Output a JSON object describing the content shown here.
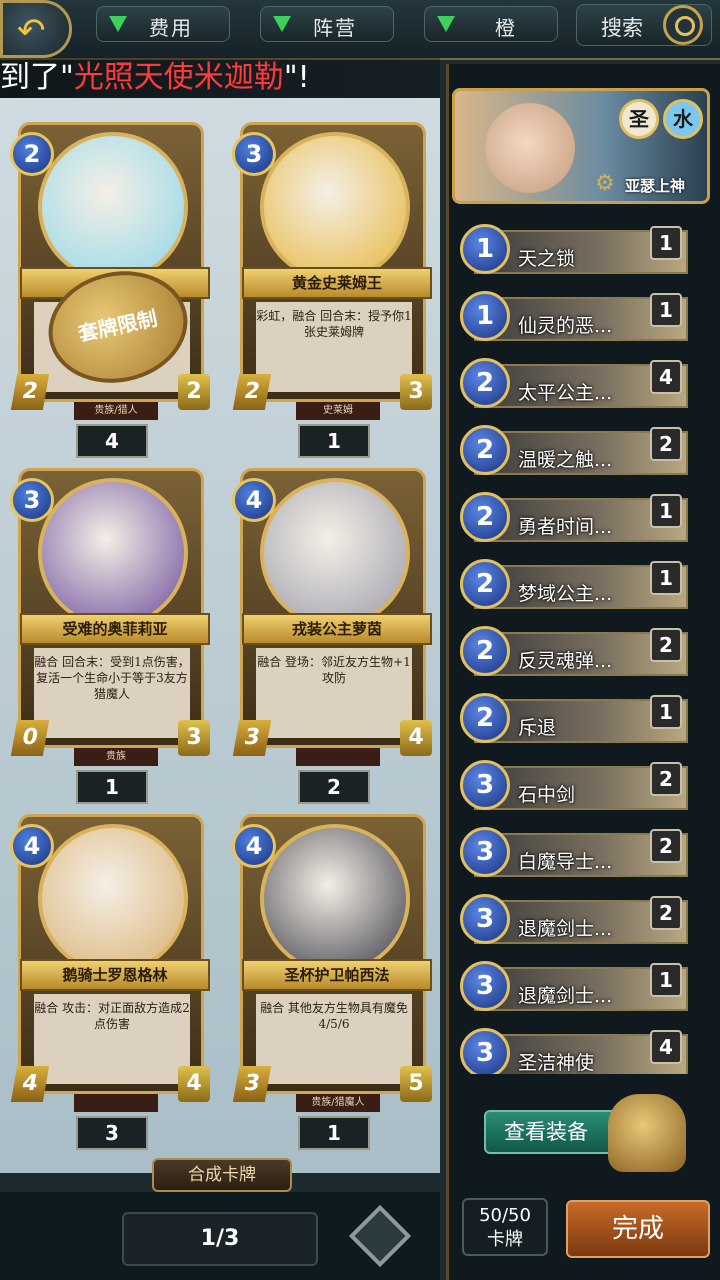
{
  "topbar": {
    "filters": [
      {
        "label": "费用"
      },
      {
        "label": "阵营"
      },
      {
        "label": "橙"
      }
    ],
    "search_label": "搜索"
  },
  "banner": {
    "prefix": "到了\"",
    "highlight": "光照天使米迦勒",
    "suffix": "\"!"
  },
  "cards": [
    {
      "name": "",
      "desc": "",
      "cost": "2",
      "atk": "2",
      "hp": "2",
      "tribe": "贵族/猎人",
      "count": "4",
      "seal": "套牌限制",
      "art_color": "#8fd6e8"
    },
    {
      "name": "黄金史莱姆王",
      "desc": "彩虹，融合\n回合末：授予你1张史莱姆牌",
      "cost": "3",
      "atk": "2",
      "hp": "3",
      "tribe": "史莱姆",
      "count": "1",
      "art_color": "#e6b53a"
    },
    {
      "name": "受难的奥菲莉亚",
      "desc": "融合\n回合末：受到1点伤害，复活一个生命小于等于3友方猎魔人",
      "cost": "3",
      "atk": "0",
      "hp": "3",
      "tribe": "贵族",
      "count": "1",
      "art_color": "#6a4a9a"
    },
    {
      "name": "戎装公主萝茵",
      "desc": "融合\n登场：邻近友方生物+1攻防",
      "cost": "4",
      "atk": "3",
      "hp": "4",
      "tribe": "",
      "count": "2",
      "art_color": "#9a9aa8"
    },
    {
      "name": "鹅骑士罗恩格林",
      "desc": "融合\n攻击：对正面敌方造成2点伤害",
      "cost": "4",
      "atk": "4",
      "hp": "4",
      "tribe": "",
      "count": "3",
      "art_color": "#d8b070"
    },
    {
      "name": "圣杯护卫帕西法",
      "desc": "融合\n其他友方生物具有魔免4/5/6",
      "cost": "4",
      "atk": "3",
      "hp": "5",
      "tribe": "贵族/猎魔人",
      "count": "1",
      "art_color": "#3a3a44"
    }
  ],
  "synth_label": "合成卡牌",
  "pager": "1/3",
  "hero": {
    "elements": [
      "圣",
      "水"
    ],
    "name": "亚瑟上神"
  },
  "deck": [
    {
      "cost": "1",
      "name": "天之锁",
      "qty": "1"
    },
    {
      "cost": "1",
      "name": "仙灵的恶...",
      "qty": "1"
    },
    {
      "cost": "2",
      "name": "太平公主...",
      "qty": "4"
    },
    {
      "cost": "2",
      "name": "温暖之触...",
      "qty": "2"
    },
    {
      "cost": "2",
      "name": "勇者时间...",
      "qty": "1"
    },
    {
      "cost": "2",
      "name": "梦域公主...",
      "qty": "1"
    },
    {
      "cost": "2",
      "name": "反灵魂弹...",
      "qty": "2"
    },
    {
      "cost": "2",
      "name": "斥退",
      "qty": "1"
    },
    {
      "cost": "3",
      "name": "石中剑",
      "qty": "2"
    },
    {
      "cost": "3",
      "name": "白魔导士...",
      "qty": "2"
    },
    {
      "cost": "3",
      "name": "退魔剑士...",
      "qty": "2"
    },
    {
      "cost": "3",
      "name": "退魔剑士...",
      "qty": "1"
    },
    {
      "cost": "3",
      "name": "圣洁神使",
      "qty": "4"
    }
  ],
  "equip_label": "查看装备",
  "deck_count": {
    "value": "50/50",
    "label": "卡牌"
  },
  "done_label": "完成"
}
